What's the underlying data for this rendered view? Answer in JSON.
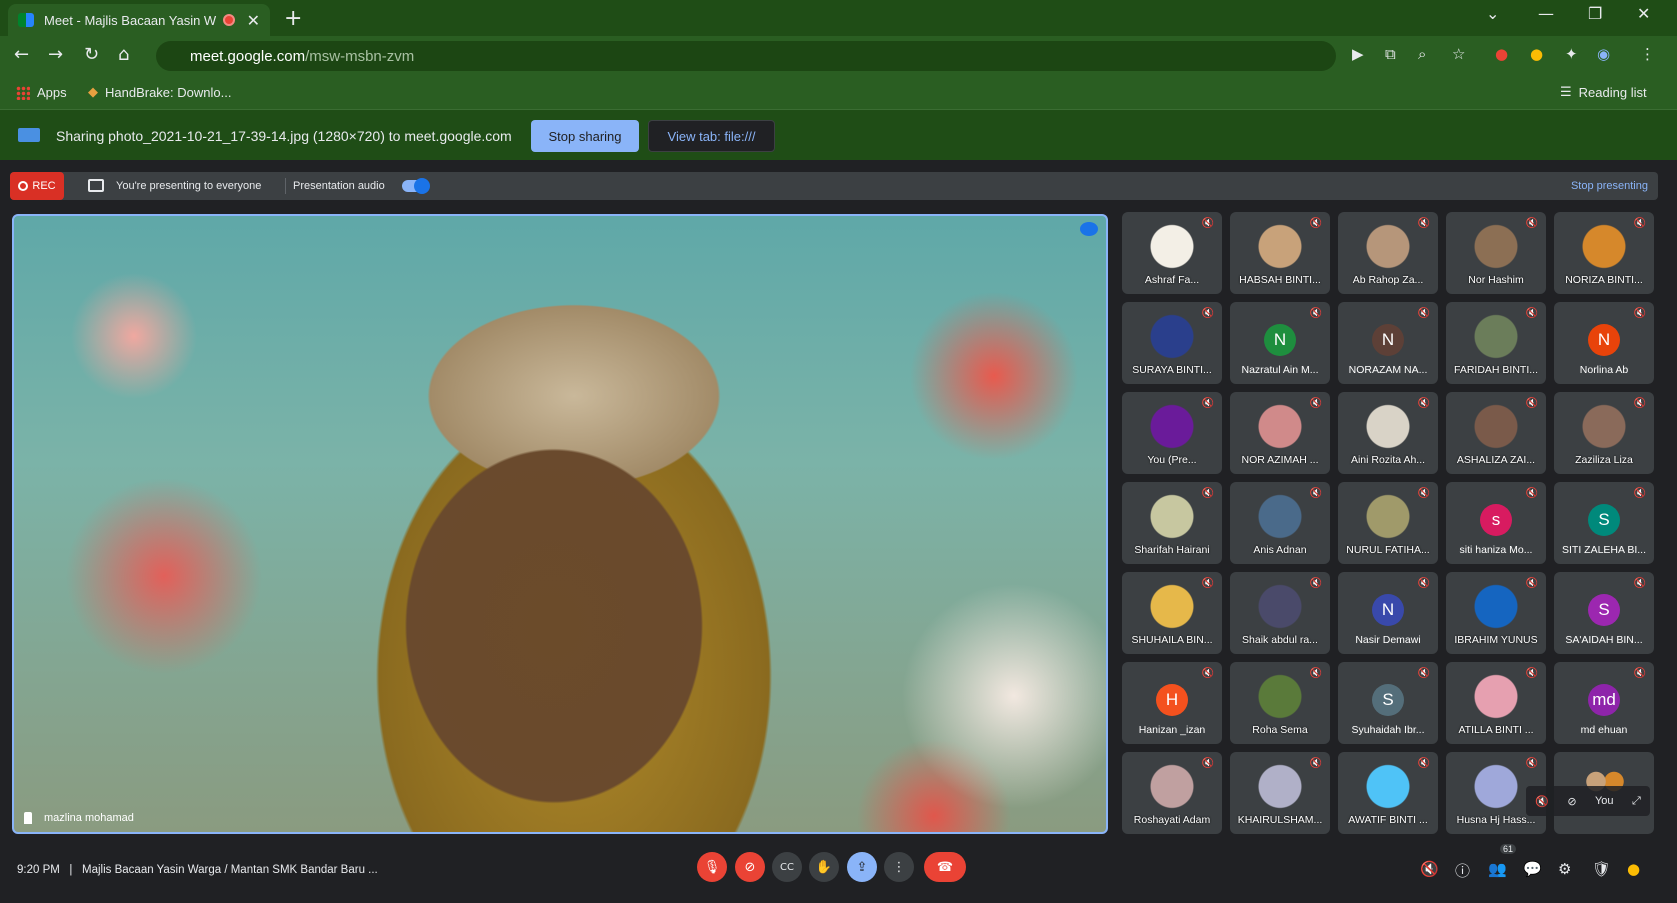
{
  "browser": {
    "tab_title": "Meet - Majlis Bacaan Yasin W",
    "tab_close": "✕",
    "new_tab": "+",
    "url_host": "meet.google.com",
    "url_path": "/msw-msbn-zvm",
    "bookmarks": [
      {
        "label": "Apps"
      },
      {
        "label": "HandBrake: Downlo..."
      }
    ],
    "reading_list": "Reading list"
  },
  "share_bar": {
    "message": "Sharing photo_2021-10-21_17-39-14.jpg (1280×720) to meet.google.com",
    "stop_sharing": "Stop sharing",
    "view_tab": "View tab: file:///"
  },
  "presentation_bar": {
    "rec": "REC",
    "presenting_text": "You're presenting to everyone",
    "audio_label": "Presentation audio",
    "audio_on": true,
    "stop_presenting": "Stop presenting"
  },
  "main_video": {
    "name": "mazlina mohamad"
  },
  "participants": [
    {
      "name": "Ashraf Fa...",
      "type": "photo",
      "color": "#f3efe6"
    },
    {
      "name": "HABSAH BINTI...",
      "type": "photo",
      "color": "#c8a27a"
    },
    {
      "name": "Ab Rahop Za...",
      "type": "photo",
      "color": "#b6967a"
    },
    {
      "name": "Nor Hashim",
      "type": "photo",
      "color": "#8c6f54"
    },
    {
      "name": "NORIZA BINTI...",
      "type": "photo",
      "color": "#d6882b"
    },
    {
      "name": "SURAYA BINTI...",
      "type": "photo",
      "color": "#2a3f8c"
    },
    {
      "name": "Nazratul Ain M...",
      "type": "letter",
      "letter": "N",
      "color": "#1e8e3e"
    },
    {
      "name": "NORAZAM NA...",
      "type": "letter",
      "letter": "N",
      "color": "#5d4037"
    },
    {
      "name": "FARIDAH BINTI...",
      "type": "photo",
      "color": "#6b7d5a"
    },
    {
      "name": "Norlina Ab",
      "type": "letter",
      "letter": "N",
      "color": "#e8430a"
    },
    {
      "name": "You (Pre...",
      "type": "photo",
      "color": "#6a1b9a"
    },
    {
      "name": "NOR AZIMAH ...",
      "type": "photo",
      "color": "#d08a8a"
    },
    {
      "name": "Aini Rozita Ah...",
      "type": "photo",
      "color": "#d9d3c7"
    },
    {
      "name": "ASHALIZA ZAI...",
      "type": "photo",
      "color": "#7a5a4a"
    },
    {
      "name": "Zaziliza Liza",
      "type": "photo",
      "color": "#8a6a5a"
    },
    {
      "name": "Sharifah Hairani",
      "type": "photo",
      "color": "#c7c7a0"
    },
    {
      "name": "Anis Adnan",
      "type": "photo",
      "color": "#4a6a8a"
    },
    {
      "name": "NURUL FATIHA...",
      "type": "photo",
      "color": "#a09a6a"
    },
    {
      "name": "siti haniza Mo...",
      "type": "letter",
      "letter": "s",
      "color": "#d81b60"
    },
    {
      "name": "SITI ZALEHA BI...",
      "type": "letter",
      "letter": "S",
      "color": "#00897b"
    },
    {
      "name": "SHUHAILA BIN...",
      "type": "photo",
      "color": "#e6b84a"
    },
    {
      "name": "Shaik abdul ra...",
      "type": "photo",
      "color": "#4a4a6a"
    },
    {
      "name": "Nasir Demawi",
      "type": "letter",
      "letter": "N",
      "color": "#3949ab"
    },
    {
      "name": "IBRAHIM YUNUS",
      "type": "photo",
      "color": "#1565c0"
    },
    {
      "name": "SA'AIDAH BIN...",
      "type": "letter",
      "letter": "S",
      "color": "#9c27b0"
    },
    {
      "name": "Hanizan _izan",
      "type": "letter",
      "letter": "H",
      "color": "#f4511e"
    },
    {
      "name": "Roha Sema",
      "type": "photo",
      "color": "#5a7a3a"
    },
    {
      "name": "Syuhaidah Ibr...",
      "type": "letter",
      "letter": "S",
      "color": "#546e7a"
    },
    {
      "name": "ATILLA BINTI ...",
      "type": "photo",
      "color": "#e6a0b0"
    },
    {
      "name": "md ehuan",
      "type": "letter",
      "letter": "md",
      "color": "#8e24aa"
    },
    {
      "name": "Roshayati Adam",
      "type": "photo",
      "color": "#c0a0a0"
    },
    {
      "name": "KHAIRULSHAM...",
      "type": "photo",
      "color": "#b0b0c8"
    },
    {
      "name": "AWATIF BINTI ...",
      "type": "photo",
      "color": "#4fc3f7"
    },
    {
      "name": "Husna Hj Hass...",
      "type": "photo",
      "color": "#9fa8da"
    },
    {
      "name": "You",
      "type": "self",
      "color": "#5f6368"
    }
  ],
  "bottom_bar": {
    "time": "9:20 PM",
    "separator": "|",
    "meeting_title": "Majlis Bacaan Yasin Warga / Mantan SMK Bandar Baru ...",
    "participant_count": "61"
  },
  "icons": {
    "mic_off": "🎙",
    "cam_off": "⊘",
    "captions": "CC",
    "hand": "✋",
    "present": "⇪",
    "more": "⋮",
    "hangup": "☎",
    "info": "ⓘ",
    "people": "👥",
    "chat": "💬",
    "activities": "⚙",
    "host": "🛡",
    "mute": "🔇"
  }
}
